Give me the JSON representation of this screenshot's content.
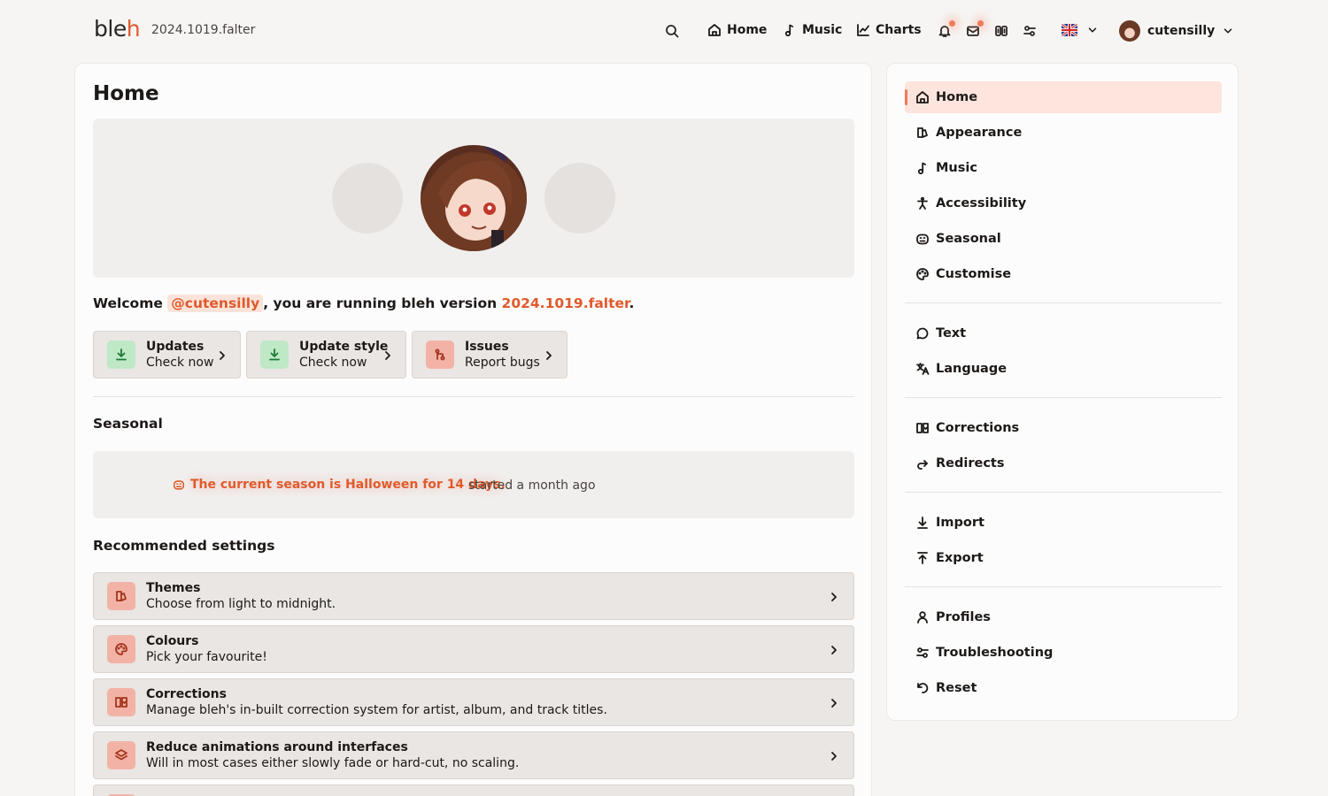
{
  "header": {
    "logo_main": "ble",
    "logo_accent": "h",
    "version": "2024.1019.falter",
    "nav": [
      {
        "label": "Home",
        "icon": "home-icon"
      },
      {
        "label": "Music",
        "icon": "music-note-icon"
      },
      {
        "label": "Charts",
        "icon": "chart-icon"
      }
    ],
    "username": "cutensilly",
    "accent_color": "#e05a2c"
  },
  "main": {
    "title": "Home",
    "welcome": {
      "prefix": "Welcome ",
      "mention": "@cutensilly",
      "middle": ", you are running bleh version ",
      "version": "2024.1019.falter",
      "suffix": "."
    },
    "quick_buttons": [
      {
        "title": "Updates",
        "subtitle": "Check now",
        "icon": "download-icon"
      },
      {
        "title": "Update style",
        "subtitle": "Check now",
        "icon": "download-icon"
      },
      {
        "title": "Issues",
        "subtitle": "Report bugs",
        "icon": "git-branch-icon"
      }
    ],
    "seasonal": {
      "heading": "Seasonal",
      "message": "The current season is Halloween for 14 days.",
      "started": "started a month ago"
    },
    "recommended": {
      "heading": "Recommended settings",
      "items": [
        {
          "title": "Themes",
          "desc": "Choose from light to midnight.",
          "icon": "palette-icon"
        },
        {
          "title": "Colours",
          "desc": "Pick your favourite!",
          "icon": "paint-icon"
        },
        {
          "title": "Corrections",
          "desc": "Manage bleh's in-built correction system for artist, album, and track titles.",
          "icon": "book-icon"
        },
        {
          "title": "Reduce animations around interfaces",
          "desc": "Will in most cases either slowly fade or hard-cut, no scaling.",
          "icon": "layers-icon"
        }
      ]
    }
  },
  "sidebar": {
    "groups": [
      [
        {
          "label": "Home",
          "icon": "home-icon",
          "active": true
        },
        {
          "label": "Appearance",
          "icon": "appearance-icon"
        },
        {
          "label": "Music",
          "icon": "music-note-icon"
        },
        {
          "label": "Accessibility",
          "icon": "accessibility-icon"
        },
        {
          "label": "Seasonal",
          "icon": "pumpkin-icon"
        },
        {
          "label": "Customise",
          "icon": "palette-icon"
        }
      ],
      [
        {
          "label": "Text",
          "icon": "speech-bubble-icon"
        },
        {
          "label": "Language",
          "icon": "translate-icon"
        }
      ],
      [
        {
          "label": "Corrections",
          "icon": "book-icon"
        },
        {
          "label": "Redirects",
          "icon": "redirect-icon"
        }
      ],
      [
        {
          "label": "Import",
          "icon": "import-icon"
        },
        {
          "label": "Export",
          "icon": "export-icon"
        }
      ],
      [
        {
          "label": "Profiles",
          "icon": "user-icon"
        },
        {
          "label": "Troubleshooting",
          "icon": "sliders-icon"
        },
        {
          "label": "Reset",
          "icon": "reset-icon"
        }
      ]
    ]
  }
}
